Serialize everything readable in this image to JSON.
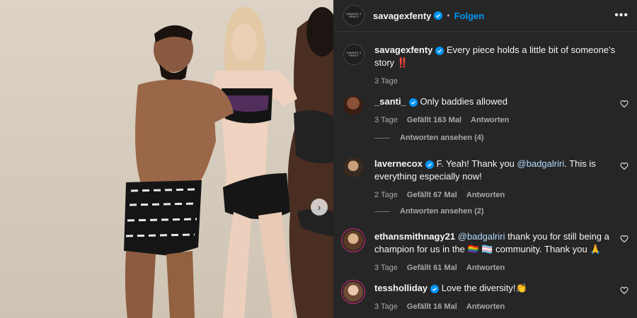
{
  "post": {
    "username": "savagexfenty",
    "follow_label": "Folgen",
    "dot": "•",
    "more_label": "•••",
    "logo_lines": [
      "SAVAGE X",
      "FENTY"
    ]
  },
  "caption": {
    "username": "savagexfenty",
    "text": "Every piece holds a little bit of someone's story",
    "emoji": "‼️",
    "time": "3 Tage"
  },
  "comments": [
    {
      "username": "_santi_",
      "verified": true,
      "text": "Only baddies allowed",
      "time": "3 Tage",
      "likes": "Gefällt 163 Mal",
      "reply": "Antworten",
      "view_replies": "Antworten ansehen (4)"
    },
    {
      "username": "lavernecox",
      "verified": true,
      "text_before": "F. Yeah! Thank you ",
      "mention": "@badgalriri",
      "text_after": ". This is everything especially now!",
      "time": "2 Tage",
      "likes": "Gefällt 67 Mal",
      "reply": "Antworten",
      "view_replies": "Antworten ansehen (2)"
    },
    {
      "username": "ethansmithnagy21",
      "verified": false,
      "mention": "@badgalriri",
      "text_after": " thank you for still being a champion for us in the",
      "text_after2": "community. Thank you",
      "emojis": [
        "🏳️‍🌈",
        "🏳️‍⚧️",
        "🙏"
      ],
      "time": "3 Tage",
      "likes": "Gefällt 61 Mal",
      "reply": "Antworten"
    },
    {
      "username": "tessholliday",
      "verified": true,
      "text": "Love the diversity!",
      "emoji": "👏",
      "time": "3 Tage",
      "likes": "Gefällt 16 Mal",
      "reply": "Antworten"
    }
  ],
  "icons": {
    "verified": "verified-badge-icon",
    "heart": "heart-icon",
    "carousel_next": "chevron-right-icon",
    "more": "more-options-icon"
  },
  "colors": {
    "panel_bg": "#262626",
    "accent": "#0095f6",
    "muted": "#a8a8a8"
  }
}
